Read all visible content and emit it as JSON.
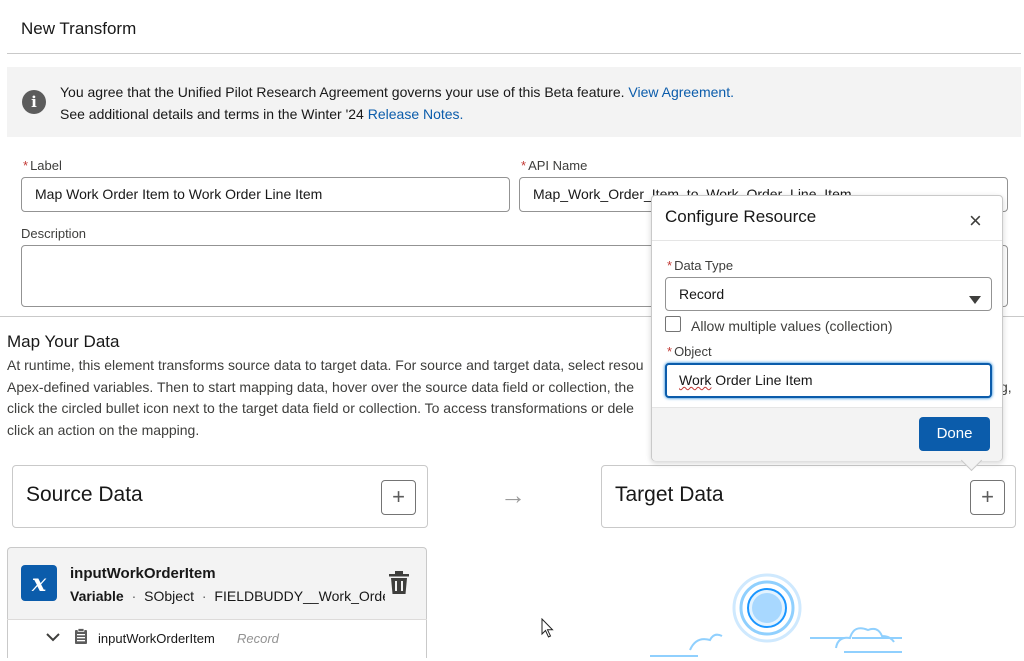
{
  "page": {
    "title": "New Transform"
  },
  "notice": {
    "line1_text": "You agree that the Unified Pilot Research Agreement governs your use of this Beta feature.",
    "line1_link": "View Agreement.",
    "line2_text": "See additional details and terms in the Winter '24",
    "line2_link": "Release Notes."
  },
  "form": {
    "label_field": {
      "required_mark": "*",
      "label": "Label",
      "value": "Map Work Order Item to Work Order Line Item"
    },
    "api_name_field": {
      "required_mark": "*",
      "label": "API Name",
      "value": "Map_Work_Order_Item_to_Work_Order_Line_Item"
    },
    "description_field": {
      "label": "Description",
      "value": ""
    }
  },
  "map_section": {
    "title": "Map Your Data",
    "paragraph_lines": [
      "At runtime, this element transforms source data to target data. For source and target data, select resou",
      "Apex-defined variables. Then to start mapping data, hover over the source data field or collection, the",
      "click the circled bullet icon next to the target data field or collection. To access transformations or dele",
      "click an action on the mapping."
    ],
    "paragraph_tail_2": "g,"
  },
  "source_card": {
    "title": "Source Data",
    "add_symbol": "+"
  },
  "target_card": {
    "title": "Target Data",
    "add_symbol": "+"
  },
  "flow_arrow": "→",
  "variable": {
    "name": "inputWorkOrderItem",
    "type_label": "Variable",
    "separator": "·",
    "object_kind": "SObject",
    "object_name": "FIELDBUDDY__Work_Order_",
    "icon_glyph": "x",
    "tree_item": {
      "name": "inputWorkOrderItem",
      "type": "Record"
    }
  },
  "popover": {
    "title": "Configure Resource",
    "close_symbol": "×",
    "data_type": {
      "required_mark": "*",
      "label": "Data Type",
      "value": "Record"
    },
    "collection_checkbox": {
      "label": "Allow multiple values (collection)",
      "checked": false
    },
    "object": {
      "required_mark": "*",
      "label": "Object",
      "value_misspelled_part": "Work",
      "value_rest": " Order Line Item"
    },
    "done_label": "Done"
  },
  "colors": {
    "brand": "#0b5cab",
    "required": "#c23934",
    "border": "#c9c9c9",
    "panel_bg": "#f3f3f3",
    "illustration": "#1b96ff"
  },
  "icons": [
    "info-icon",
    "plus-icon",
    "arrow-right-icon",
    "variable-icon",
    "trash-icon",
    "chevron-down-icon",
    "record-icon",
    "close-icon",
    "dropdown-caret-icon",
    "cursor-icon",
    "empty-state-illustration"
  ]
}
